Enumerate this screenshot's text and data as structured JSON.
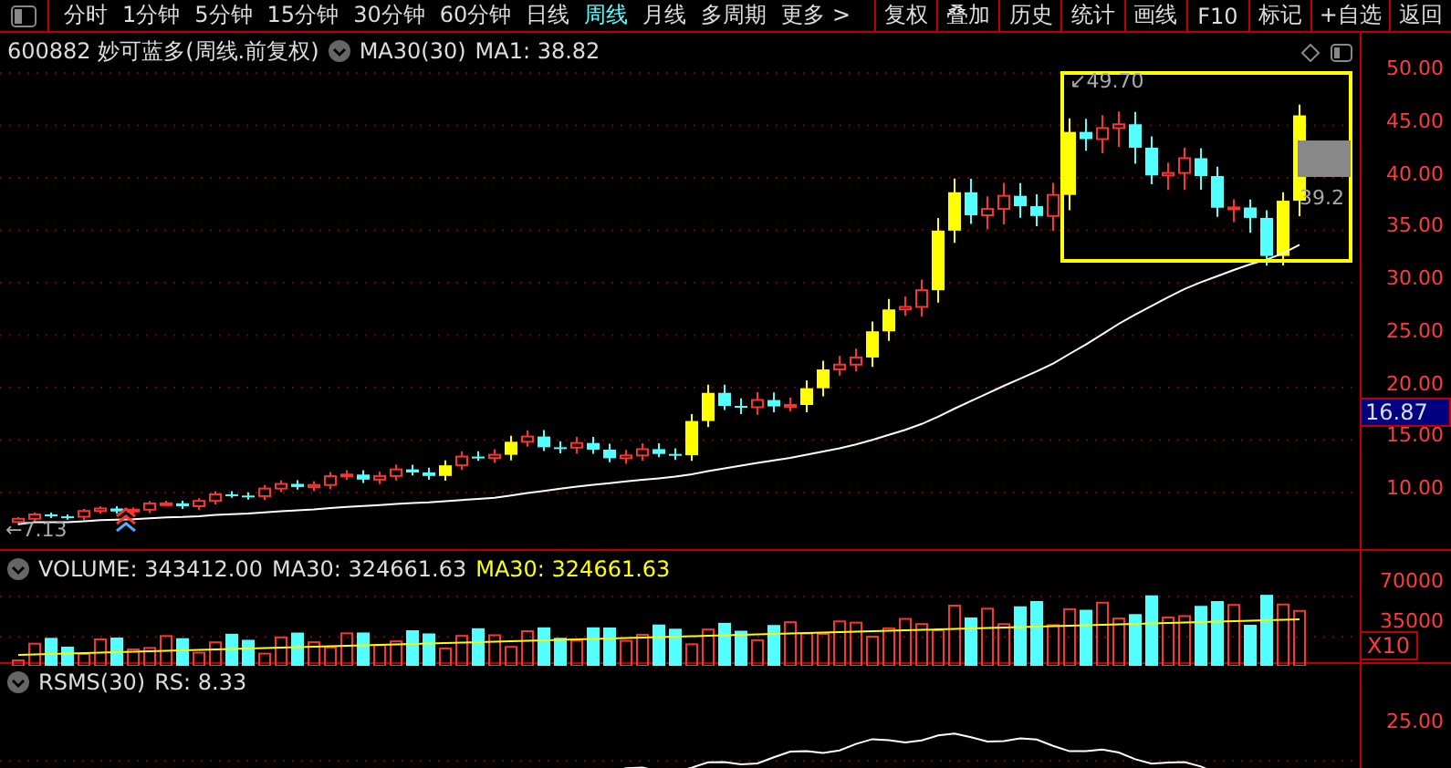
{
  "toolbar": {
    "tabs": [
      {
        "label": "分时",
        "selected": false
      },
      {
        "label": "1分钟",
        "selected": false
      },
      {
        "label": "5分钟",
        "selected": false
      },
      {
        "label": "15分钟",
        "selected": false
      },
      {
        "label": "30分钟",
        "selected": false
      },
      {
        "label": "60分钟",
        "selected": false
      },
      {
        "label": "日线",
        "selected": false
      },
      {
        "label": "周线",
        "selected": true
      },
      {
        "label": "月线",
        "selected": false
      },
      {
        "label": "多周期",
        "selected": false
      },
      {
        "label": "更多 >",
        "selected": false
      }
    ],
    "buttons": [
      "复权",
      "叠加",
      "历史",
      "统计",
      "画线",
      "F10",
      "标记",
      "+自选",
      "返回"
    ]
  },
  "price_pane": {
    "title": "600882 妙可蓝多(周线.前复权)",
    "indicator": "MA30(30)",
    "ma_value": "MA1: 38.82",
    "high_label": "↙49.70",
    "low_label": "←7.13",
    "last_label": "39.2",
    "axis_ticks": [
      "50.00",
      "45.00",
      "40.00",
      "35.00",
      "30.00",
      "25.00",
      "20.00",
      "15.00",
      "10.00"
    ],
    "current_price": "16.87"
  },
  "volume_pane": {
    "volume": "VOLUME: 343412.00",
    "ma": "MA30: 324661.63",
    "ma_highlight": "MA30: 324661.63",
    "axis_ticks": [
      "70000",
      "35000"
    ],
    "scale": "X10"
  },
  "rsms_pane": {
    "title": "RSMS(30)",
    "value": "RS: 8.33",
    "axis_ticks": [
      "25.00"
    ]
  }
}
